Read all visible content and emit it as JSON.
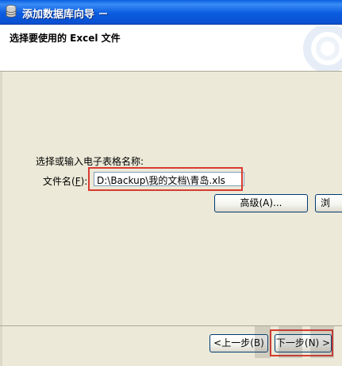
{
  "window": {
    "title": "添加数据库向导 －",
    "icon": "database-icon"
  },
  "header": {
    "heading": "选择要使用的 Excel 文件"
  },
  "form": {
    "prompt": "选择或输入电子表格名称:",
    "filename_label": "文件名(",
    "filename_hotkey": "F",
    "filename_label_end": "):",
    "filename_value": "D:\\Backup\\我的文档\\青岛.xls",
    "advanced_button": "高级(A)...",
    "browse_button_partial": "浏"
  },
  "footer": {
    "back_button": "<上一步(B)",
    "next_button": "下一步(N) >"
  },
  "colors": {
    "highlight": "#d83b30",
    "titlebar": "#0a5fe0"
  }
}
